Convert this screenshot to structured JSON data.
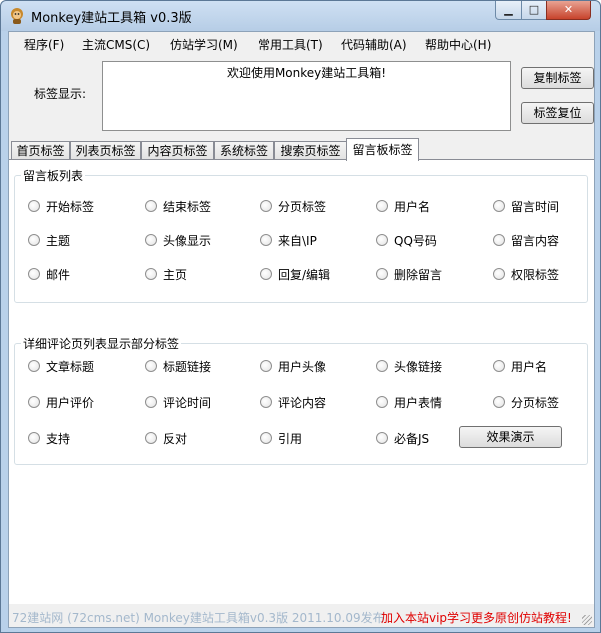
{
  "window": {
    "title": "Monkey建站工具箱 v0.3版",
    "min_label": "▁",
    "max_label": "□",
    "close_label": "✕"
  },
  "menu": [
    "程序(F)",
    "主流CMS(C)",
    "仿站学习(M)",
    "常用工具(T)",
    "代码辅助(A)",
    "帮助中心(H)"
  ],
  "tag": {
    "label": "标签显示:",
    "content": "欢迎使用Monkey建站工具箱!",
    "copy_button": "复制标签",
    "reset_button": "标签复位"
  },
  "tabs": [
    "首页标签",
    "列表页标签",
    "内容页标签",
    "系统标签",
    "搜索页标签",
    "留言板标签"
  ],
  "active_tab": "留言板标签",
  "guestbook": {
    "title": "留言板列表",
    "rows": [
      [
        "开始标签",
        "结束标签",
        "分页标签",
        "用户名",
        "留言时间"
      ],
      [
        "主题",
        "头像显示",
        "来自\\IP",
        "QQ号码",
        "留言内容"
      ],
      [
        "邮件",
        "主页",
        "回复/编辑",
        "删除留言",
        "权限标签"
      ]
    ]
  },
  "comments": {
    "title": "详细评论页列表显示部分标签",
    "rows": [
      [
        "文章标题",
        "标题链接",
        "用户头像",
        "头像链接",
        "用户名"
      ],
      [
        "用户评价",
        "评论时间",
        "评论内容",
        "用户表情",
        "分页标签"
      ],
      [
        "支持",
        "反对",
        "引用",
        "必备JS"
      ]
    ],
    "demo_button": "效果演示"
  },
  "status": {
    "left": "72建站网 (72cms.net) Monkey建站工具箱v0.3版    2011.10.09发布",
    "right": "加入本站vip学习更多原创仿站教程!"
  },
  "colors": {
    "status_link": "#a4b8cc",
    "status_promo": "#e00000",
    "accent": "#b9d1ea"
  }
}
